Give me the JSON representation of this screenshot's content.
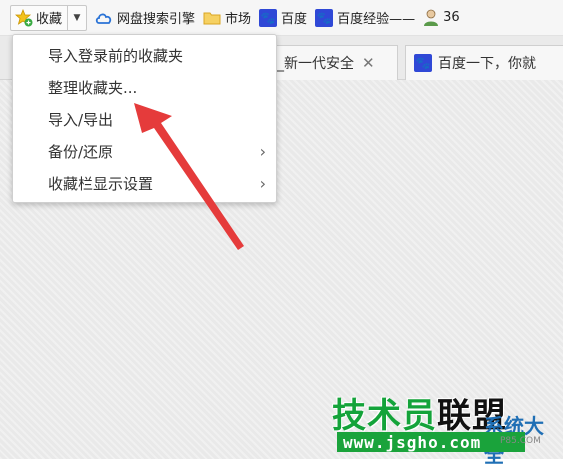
{
  "favbar": {
    "main_label": "收藏",
    "items": [
      {
        "label": "网盘搜索引擎",
        "icon": "cloud-icon"
      },
      {
        "label": "市场",
        "icon": "folder-icon"
      },
      {
        "label": "百度",
        "icon": "baidu-paw-icon"
      },
      {
        "label": "百度经验——",
        "icon": "baidu-paw-icon"
      },
      {
        "label": "36",
        "icon": "user-icon"
      }
    ]
  },
  "tabs": [
    {
      "label": "_新一代安全"
    },
    {
      "label": "百度一下，你就"
    }
  ],
  "menu": {
    "items": [
      {
        "label": "导入登录前的收藏夹",
        "submenu": false
      },
      {
        "label": "整理收藏夹...",
        "submenu": false
      },
      {
        "label": "导入/导出",
        "submenu": false
      },
      {
        "label": "备份/还原",
        "submenu": true
      },
      {
        "label": "收藏栏显示设置",
        "submenu": true
      }
    ]
  },
  "watermark": {
    "title_a": "技术员",
    "title_b": "联盟",
    "url": "www.jsgho.com",
    "side": "系统大全",
    "small": "P85.COM"
  },
  "colors": {
    "accent_arrow": "#e53b3b",
    "watermark_green": "#14a33a",
    "baidu_blue": "#2f48d6"
  }
}
